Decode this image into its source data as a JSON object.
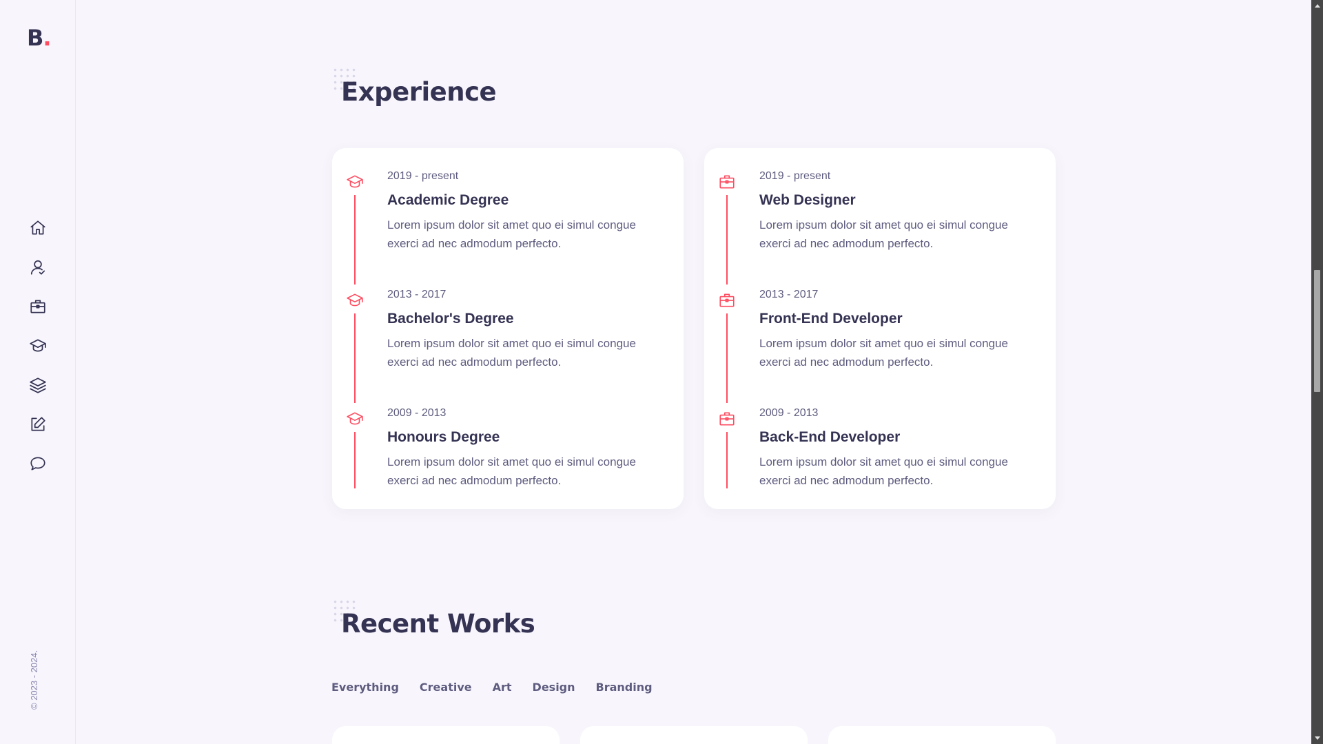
{
  "sidebar": {
    "logo_letter": "B",
    "logo_dot": ".",
    "nav": [
      {
        "name": "home-icon"
      },
      {
        "name": "user-icon"
      },
      {
        "name": "briefcase-icon"
      },
      {
        "name": "graduation-cap-icon"
      },
      {
        "name": "layers-icon"
      },
      {
        "name": "edit-icon"
      },
      {
        "name": "chat-icon"
      }
    ],
    "copyright": "© 2023 - 2024."
  },
  "experience": {
    "title": "Experience",
    "education": [
      {
        "date": "2019 - present",
        "title": "Academic Degree",
        "desc": "Lorem ipsum dolor sit amet quo ei simul congue exerci ad nec admodum perfecto."
      },
      {
        "date": "2013 - 2017",
        "title": "Bachelor's Degree",
        "desc": "Lorem ipsum dolor sit amet quo ei simul congue exerci ad nec admodum perfecto."
      },
      {
        "date": "2009 - 2013",
        "title": "Honours Degree",
        "desc": "Lorem ipsum dolor sit amet quo ei simul congue exerci ad nec admodum perfecto."
      }
    ],
    "work": [
      {
        "date": "2019 - present",
        "title": "Web Designer",
        "desc": "Lorem ipsum dolor sit amet quo ei simul congue exerci ad nec admodum perfecto."
      },
      {
        "date": "2013 - 2017",
        "title": "Front-End Developer",
        "desc": "Lorem ipsum dolor sit amet quo ei simul congue exerci ad nec admodum perfecto."
      },
      {
        "date": "2009 - 2013",
        "title": "Back-End Developer",
        "desc": "Lorem ipsum dolor sit amet quo ei simul congue exerci ad nec admodum perfecto."
      }
    ]
  },
  "works": {
    "title": "Recent Works",
    "filters": [
      "Everything",
      "Creative",
      "Art",
      "Design",
      "Branding"
    ]
  },
  "colors": {
    "accent": "#ff4c60",
    "text": "#353353",
    "background": "#f8f6fc"
  }
}
